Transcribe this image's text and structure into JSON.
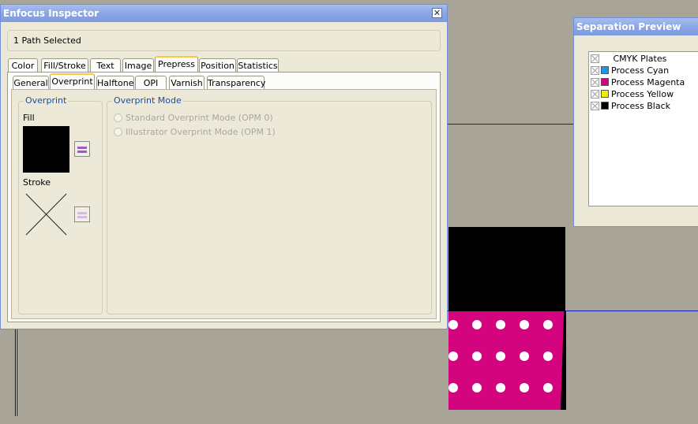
{
  "inspector": {
    "title": "Enfocus Inspector",
    "status": "1 Path Selected",
    "tabs": [
      "Color",
      "Fill/Stroke",
      "Text",
      "Image",
      "Prepress",
      "Position",
      "Statistics"
    ],
    "active_tab": "Prepress",
    "subtabs": [
      "General",
      "Overprint",
      "Halftone",
      "OPI",
      "Varnish",
      "Transparency"
    ],
    "active_subtab": "Overprint",
    "overprint_group": {
      "title": "Overprint",
      "fill_label": "Fill",
      "stroke_label": "Stroke"
    },
    "mode_group": {
      "title": "Overprint Mode",
      "options": [
        "Standard Overprint Mode (OPM 0)",
        "Illustrator Overprint Mode (OPM 1)"
      ]
    }
  },
  "separation_preview": {
    "title": "Separation Preview",
    "plates": [
      {
        "label": "CMYK Plates",
        "color": ""
      },
      {
        "label": "Process Cyan",
        "color": "#1e96e6"
      },
      {
        "label": "Process Magenta",
        "color": "#d4047e"
      },
      {
        "label": "Process Yellow",
        "color": "#f4ec00"
      },
      {
        "label": "Process Black",
        "color": "#000000"
      }
    ]
  },
  "colors": {
    "canvas": "#a8a598",
    "magenta": "#d4047e",
    "guide": "#1818c8"
  }
}
